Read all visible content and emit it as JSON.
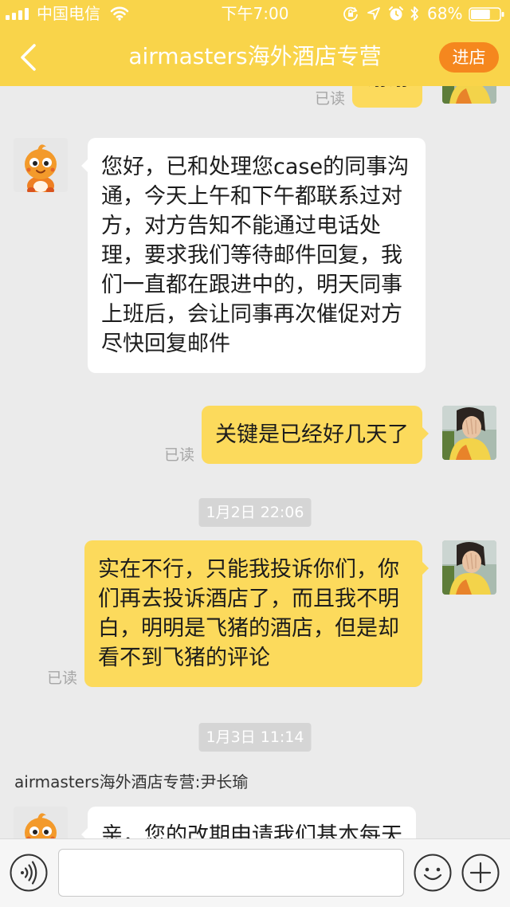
{
  "status_bar": {
    "carrier": "中国电信",
    "time": "下午7:00",
    "battery_percent": "68%",
    "battery_level": 0.68,
    "signal_bars": 4,
    "icons": [
      "signal-icon",
      "wifi-icon",
      "rotation-lock-icon",
      "location-icon",
      "alarm-icon",
      "bluetooth-icon",
      "battery-icon"
    ]
  },
  "nav": {
    "back_icon": "chevron-left-icon",
    "title": "airmasters海外酒店专营",
    "shop_button_label": "进店"
  },
  "chat": {
    "messages": [
      {
        "side": "right",
        "text": "谢谢",
        "read_status": "已读"
      },
      {
        "side": "left",
        "text": "您好，已和处理您case的同事沟通，今天上午和下午都联系过对方，对方告知不能通过电话处理，要求我们等待邮件回复，我们一直都在跟进中的，明天同事上班后，会让同事再次催促对方尽快回复邮件"
      },
      {
        "side": "right",
        "text": "关键是已经好几天了",
        "read_status": "已读"
      },
      {
        "side": "right",
        "text": "实在不行，只能我投诉你们，你们再去投诉酒店了，而且我不明白，明明是飞猪的酒店，但是却看不到飞猪的评论",
        "read_status": "已读"
      },
      {
        "side": "left",
        "text": "亲，您的改期申请我们基本每天"
      }
    ],
    "timestamps": [
      "1月2日 22:06",
      "1月3日 11:14"
    ],
    "sender_label": "airmasters海外酒店专营:尹长瑜"
  },
  "input_bar": {
    "voice_icon": "voice-icon",
    "value": "",
    "placeholder": "",
    "emoji_icon": "emoji-icon",
    "plus_icon": "plus-icon"
  },
  "colors": {
    "brand_yellow": "#F9D44A",
    "bubble_yellow": "#FCDA5C",
    "chat_bg": "#EBEBEB",
    "shop_button": "#F5871E"
  }
}
